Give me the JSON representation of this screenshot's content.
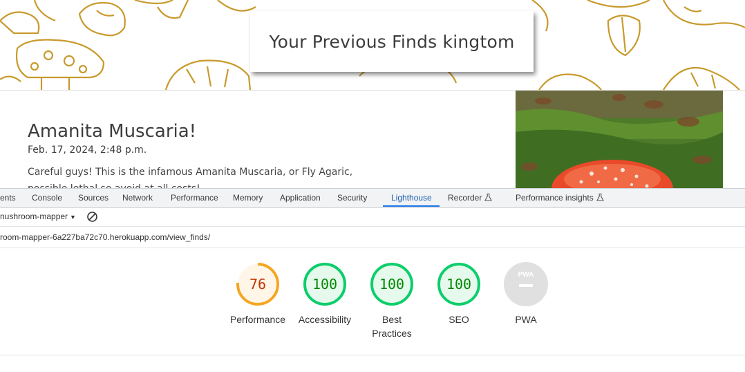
{
  "page": {
    "heading": "Your Previous Finds kingtom",
    "find": {
      "title": "Amanita Muscaria!",
      "date": "Feb. 17, 2024, 2:48 p.m.",
      "description": "Careful guys! This is the infamous Amanita Muscaria, or Fly Agaric, possible lethal so avoid at all costs!"
    }
  },
  "devtools": {
    "tabs": [
      {
        "label": "ents"
      },
      {
        "label": "Console"
      },
      {
        "label": "Sources"
      },
      {
        "label": "Network"
      },
      {
        "label": "Performance"
      },
      {
        "label": "Memory"
      },
      {
        "label": "Application"
      },
      {
        "label": "Security"
      },
      {
        "label": "Lighthouse",
        "active": true
      },
      {
        "label": "Recorder",
        "icon": "flask-icon"
      },
      {
        "label": "Performance insights",
        "icon": "flask-icon"
      }
    ],
    "report_select": "nushroom-mapper",
    "url": "room-mapper-6a227ba72c70.herokuapp.com/view_finds/",
    "scores": [
      {
        "label": "Performance",
        "value": "76",
        "fraction": 0.76,
        "color": "#f5a623",
        "bg": "#fff6e8",
        "text_color": "#c33300"
      },
      {
        "label": "Accessibility",
        "value": "100",
        "fraction": 1.0,
        "color": "#0cce6b",
        "bg": "#e6f9ed",
        "text_color": "#008800"
      },
      {
        "label": "Best Practices",
        "value": "100",
        "fraction": 1.0,
        "color": "#0cce6b",
        "bg": "#e6f9ed",
        "text_color": "#008800"
      },
      {
        "label": "SEO",
        "value": "100",
        "fraction": 1.0,
        "color": "#0cce6b",
        "bg": "#e6f9ed",
        "text_color": "#008800"
      },
      {
        "label": "PWA",
        "value": "PWA",
        "fraction": 0,
        "color": "#cccccc",
        "bg": "#e0e0e0",
        "text_color": "#ffffff"
      }
    ]
  }
}
